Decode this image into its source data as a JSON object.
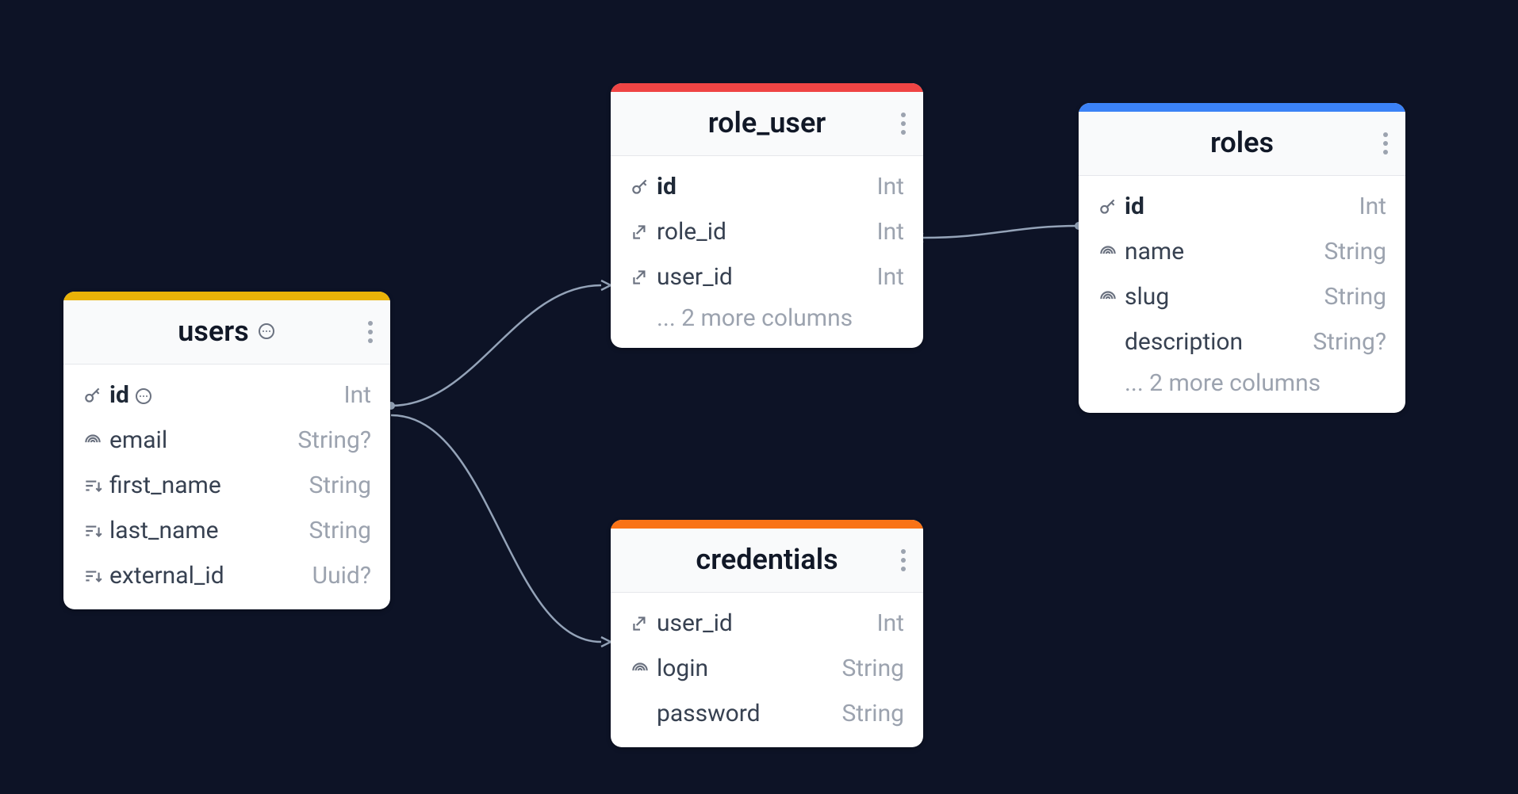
{
  "entities": {
    "users": {
      "title": "users",
      "accent": "#eab308",
      "has_comment": true,
      "columns": [
        {
          "name": "id",
          "type": "Int",
          "icon": "key",
          "pk": true,
          "has_comment": true
        },
        {
          "name": "email",
          "type": "String?",
          "icon": "fingerprint"
        },
        {
          "name": "first_name",
          "type": "String",
          "icon": "sort"
        },
        {
          "name": "last_name",
          "type": "String",
          "icon": "sort"
        },
        {
          "name": "external_id",
          "type": "Uuid?",
          "icon": "sort"
        }
      ]
    },
    "role_user": {
      "title": "role_user",
      "accent": "#ef4444",
      "columns": [
        {
          "name": "id",
          "type": "Int",
          "icon": "key",
          "pk": true
        },
        {
          "name": "role_id",
          "type": "Int",
          "icon": "link"
        },
        {
          "name": "user_id",
          "type": "Int",
          "icon": "link"
        }
      ],
      "more": "... 2 more columns"
    },
    "roles": {
      "title": "roles",
      "accent": "#3b82f6",
      "columns": [
        {
          "name": "id",
          "type": "Int",
          "icon": "key",
          "pk": true
        },
        {
          "name": "name",
          "type": "String",
          "icon": "fingerprint"
        },
        {
          "name": "slug",
          "type": "String",
          "icon": "fingerprint"
        },
        {
          "name": "description",
          "type": "String?",
          "icon": "none"
        }
      ],
      "more": "... 2 more columns"
    },
    "credentials": {
      "title": "credentials",
      "accent": "#f97316",
      "columns": [
        {
          "name": "user_id",
          "type": "Int",
          "icon": "link"
        },
        {
          "name": "login",
          "type": "String",
          "icon": "fingerprint"
        },
        {
          "name": "password",
          "type": "String",
          "icon": "none"
        }
      ]
    }
  },
  "relationships": [
    {
      "from": "users.id",
      "to": "role_user.user_id"
    },
    {
      "from": "role_user.role_id",
      "to": "roles.id"
    },
    {
      "from": "users.id",
      "to": "credentials.user_id"
    }
  ]
}
